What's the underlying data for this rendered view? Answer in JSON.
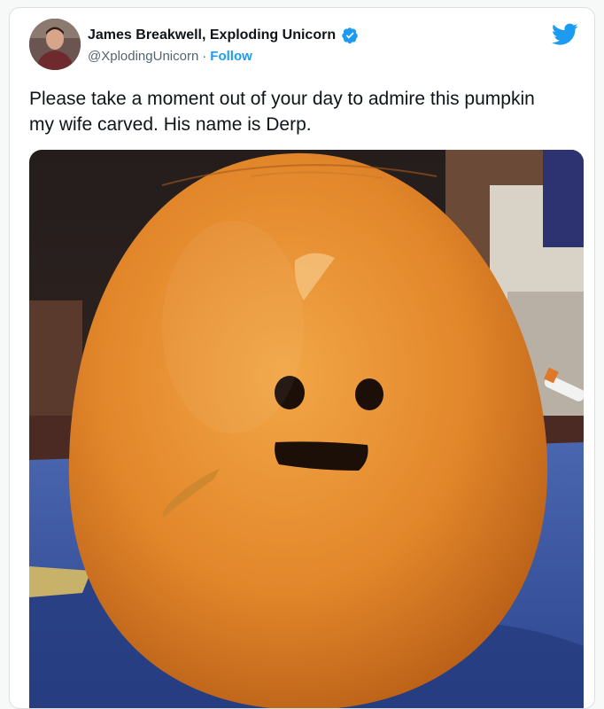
{
  "tweet": {
    "author_name": "James Breakwell, Exploding Unicorn",
    "handle": "@XplodingUnicorn",
    "separator": "·",
    "follow_label": "Follow",
    "text": "Please take a moment out of your day to admire this pumpkin my wife carved. His name is Derp.",
    "verified": true
  },
  "icons": {
    "verified": "verified-badge-icon",
    "brand": "twitter-bird-icon"
  },
  "colors": {
    "accent": "#1d9bf0",
    "pumpkin": "#e08a2a",
    "towel": "#3b5aa6"
  }
}
